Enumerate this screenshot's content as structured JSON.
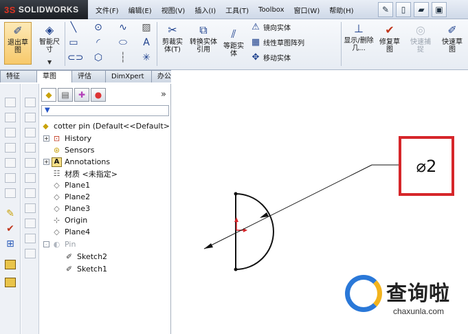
{
  "app": {
    "logo_text": "SOLIDWORKS",
    "logo_mark": "3S"
  },
  "menu": [
    "文件(F)",
    "编辑(E)",
    "视图(V)",
    "插入(I)",
    "工具(T)",
    "Toolbox",
    "窗口(W)",
    "帮助(H)"
  ],
  "ribbon": {
    "exit_sketch": "退出草图",
    "smart_dimension": "智能尺寸",
    "trim_entities": "剪裁实体(T)",
    "convert_entities": "转换实体引用",
    "offset_entities": "等距实体",
    "mirror_entities": "镜向实体",
    "linear_pattern": "线性草图阵列",
    "move_entities": "移动实体",
    "display_delete_relations": "显示/删除几...",
    "repair_sketch": "修复草图",
    "quick_snaps": "快速捕捉",
    "rapid_sketch": "快速草图"
  },
  "tabs": [
    "特征",
    "草图",
    "评估",
    "DimXpert",
    "办公室产品"
  ],
  "active_tab": 1,
  "feature_tree": {
    "expand_glyph": "»",
    "root": "cotter pin  (Default<<Default>",
    "items": [
      {
        "label": "History",
        "expander": "+"
      },
      {
        "label": "Sensors",
        "expander": ""
      },
      {
        "label": "Annotations",
        "expander": "+"
      },
      {
        "label": "材质 <未指定>",
        "expander": ""
      },
      {
        "label": "Plane1",
        "expander": ""
      },
      {
        "label": "Plane2",
        "expander": ""
      },
      {
        "label": "Plane3",
        "expander": ""
      },
      {
        "label": "Origin",
        "expander": ""
      },
      {
        "label": "Plane4",
        "expander": ""
      },
      {
        "label": "Pin",
        "expander": "-"
      },
      {
        "label": "Sketch2",
        "expander": ""
      },
      {
        "label": "Sketch1",
        "expander": ""
      }
    ]
  },
  "dimension": {
    "text": "⌀2"
  },
  "watermark": {
    "title": "查询啦",
    "url": "chaxunla.com"
  }
}
